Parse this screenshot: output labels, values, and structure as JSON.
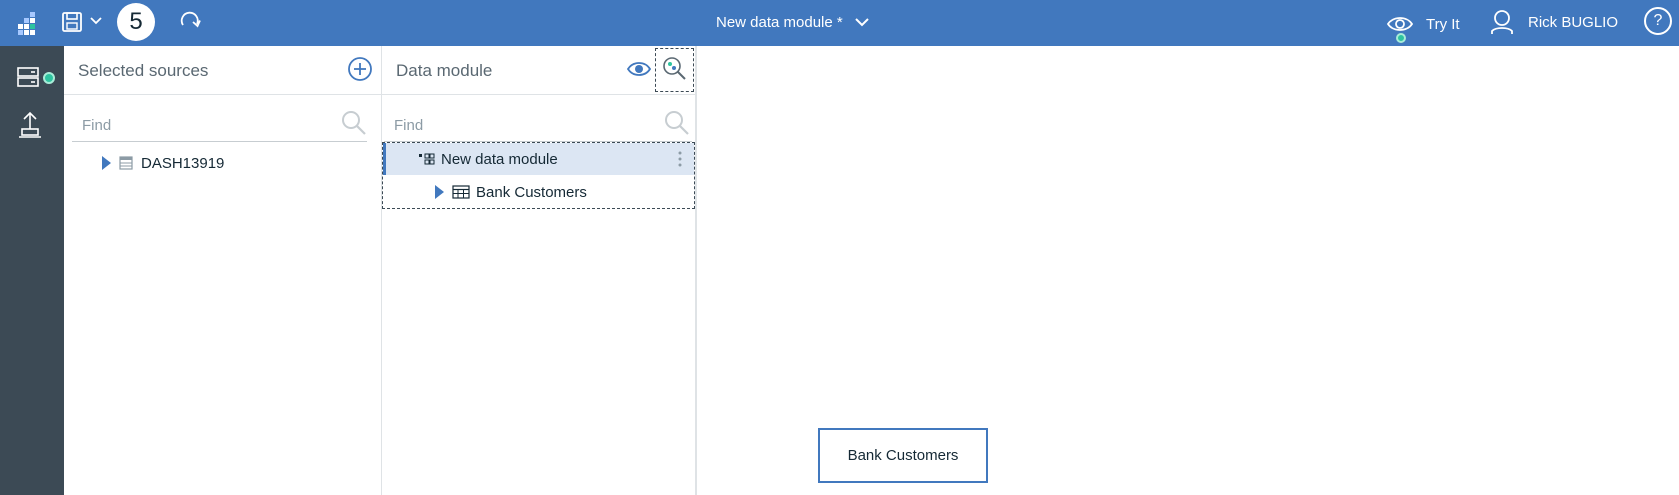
{
  "topbar": {
    "step_number": "5",
    "module_title": "New data module *",
    "try_it_label": "Try It",
    "user_name": "Rick BUGLIO",
    "help_label": "?",
    "colors": {
      "bar": "#4178be",
      "status_dot": "#2ec4a0"
    },
    "icons": [
      "app-grid-icon",
      "save-icon",
      "chevron-down-icon",
      "redo-icon",
      "eye-icon",
      "user-icon",
      "help-icon"
    ]
  },
  "left_rail": {
    "icons": [
      "data-server-icon",
      "upload-icon"
    ]
  },
  "sources_panel": {
    "title": "Selected sources",
    "find_placeholder": "Find",
    "items": [
      {
        "label": "DASH13919"
      }
    ]
  },
  "module_panel": {
    "title": "Data module",
    "find_placeholder": "Find",
    "tree": {
      "root_label": "New data module",
      "children": [
        {
          "label": "Bank Customers"
        }
      ]
    }
  },
  "canvas": {
    "nodes": [
      {
        "label": "Bank Customers"
      }
    ]
  }
}
